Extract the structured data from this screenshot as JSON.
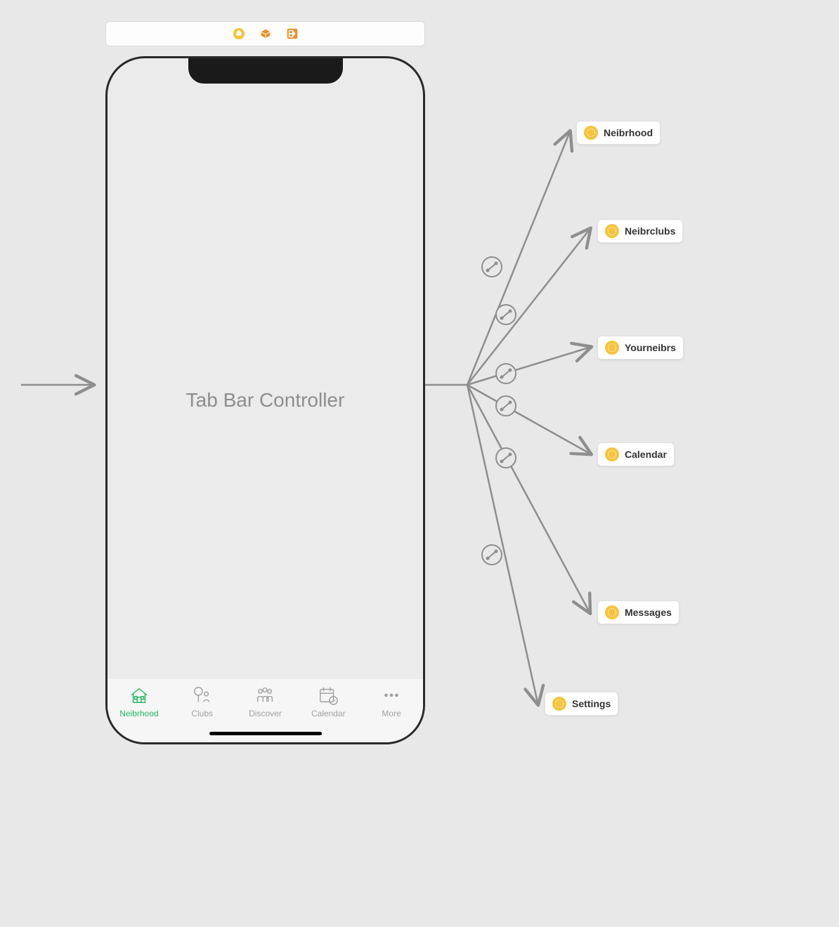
{
  "screen_title": "Tab Bar Controller",
  "tabs": [
    {
      "label": "Neibrhood",
      "active": true
    },
    {
      "label": "Clubs",
      "active": false
    },
    {
      "label": "Discover",
      "active": false
    },
    {
      "label": "Calendar",
      "active": false
    },
    {
      "label": "More",
      "active": false
    }
  ],
  "destinations": [
    {
      "label": "Neibrhood"
    },
    {
      "label": "Neibrclubs"
    },
    {
      "label": "Yourneibrs"
    },
    {
      "label": "Calendar"
    },
    {
      "label": "Messages"
    },
    {
      "label": "Settings"
    }
  ]
}
